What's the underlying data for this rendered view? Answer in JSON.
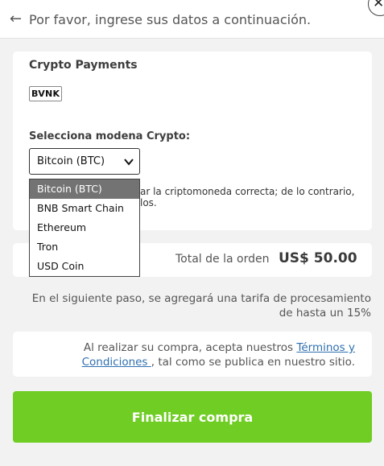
{
  "header": {
    "back_icon": "arrow-left-icon",
    "title": "Por favor, ingrese sus datos a continuación.",
    "close_icon": "close-icon"
  },
  "crypto_card": {
    "title": "Crypto Payments",
    "provider_logo": "BVNK",
    "select_label": "Selecciona modena Crypto:",
    "selected_value": "Bitcoin (BTC)",
    "warning_visible_fragment": "ar la criptomoneda correcta; de lo contrario,",
    "warning_visible_fragment2": "los."
  },
  "dropdown": {
    "options": [
      {
        "label": "Bitcoin (BTC)",
        "selected": true
      },
      {
        "label": "BNB Smart Chain",
        "selected": false
      },
      {
        "label": "Ethereum",
        "selected": false
      },
      {
        "label": "Tron",
        "selected": false
      },
      {
        "label": "USD Coin",
        "selected": false
      }
    ]
  },
  "order": {
    "total_label": "Total de la orden",
    "total_amount": "US$ 50.00"
  },
  "fee_note": "En el siguiente paso, se agregará una tarifa de procesamiento de hasta un 15%",
  "terms": {
    "prefix": "Al realizar su compra, acepta nuestros ",
    "link_text": "Términos y Condiciones ",
    "suffix": ", tal como se publica en nuestro sitio."
  },
  "submit_label": "Finalizar compra",
  "colors": {
    "accent_green": "#6fcd23",
    "link_blue": "#2f6fb0",
    "selected_option_bg": "#737373",
    "page_bg": "#f2f2f2"
  }
}
